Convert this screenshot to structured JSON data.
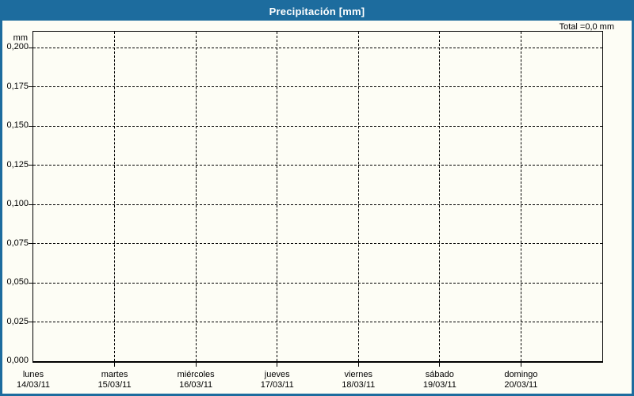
{
  "window": {
    "title": "Precipitación [mm]"
  },
  "summary": {
    "total_label": "Total =0,0 mm"
  },
  "colors": {
    "accent": "#1d6c9e",
    "background": "#fdfdf5",
    "plot_border": "#000000",
    "grid": "#000000",
    "text": "#000000",
    "title_text": "#ffffff"
  },
  "chart_data": {
    "type": "bar",
    "title": "Precipitación [mm]",
    "ylabel": "mm",
    "ylabel_unit": "mm",
    "total_mm": "0,0",
    "grid": "dashed",
    "legend": "none",
    "y_axis": {
      "min": 0.0,
      "max": 0.2,
      "tick_step": 0.025,
      "ticks": [
        {
          "value": 0.2,
          "label": "0,200"
        },
        {
          "value": 0.175,
          "label": "0,175"
        },
        {
          "value": 0.15,
          "label": "0,150"
        },
        {
          "value": 0.125,
          "label": "0,125"
        },
        {
          "value": 0.1,
          "label": "0,100"
        },
        {
          "value": 0.075,
          "label": "0,075"
        },
        {
          "value": 0.05,
          "label": "0,050"
        },
        {
          "value": 0.025,
          "label": "0,025"
        },
        {
          "value": 0.0,
          "label": "0,000"
        }
      ]
    },
    "categories": [
      {
        "day": "lunes",
        "date": "14/03/11"
      },
      {
        "day": "martes",
        "date": "15/03/11"
      },
      {
        "day": "miércoles",
        "date": "16/03/11"
      },
      {
        "day": "jueves",
        "date": "17/03/11"
      },
      {
        "day": "viernes",
        "date": "18/03/11"
      },
      {
        "day": "sábado",
        "date": "19/03/11"
      },
      {
        "day": "domingo",
        "date": "20/03/11"
      }
    ],
    "series": [
      {
        "name": "Precipitación",
        "values": [
          0,
          0,
          0,
          0,
          0,
          0,
          0
        ]
      }
    ]
  }
}
